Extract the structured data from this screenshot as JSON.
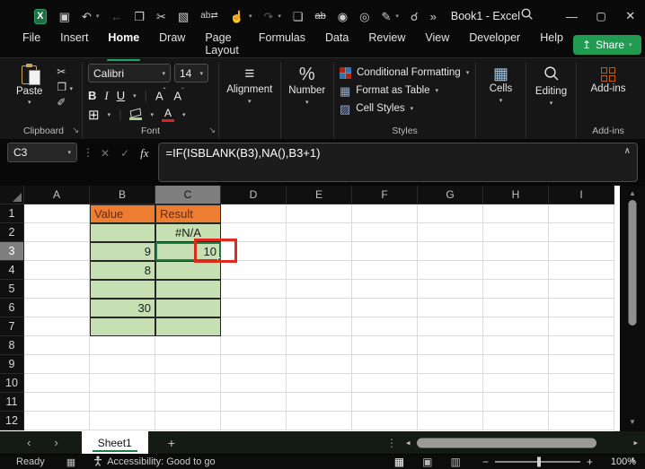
{
  "titlebar": {
    "title": "Book1 - Excel",
    "excel_logo": "X",
    "qat": [
      {
        "name": "save-icon",
        "glyph": "▣"
      },
      {
        "name": "undo-icon",
        "glyph": "↶",
        "chevron": true
      },
      {
        "name": "back-arrow-icon",
        "glyph": "←",
        "dim": true
      },
      {
        "name": "copy-icon",
        "glyph": "❐"
      },
      {
        "name": "cut-icon",
        "glyph": "✂"
      },
      {
        "name": "picture-edit-icon",
        "glyph": "▧"
      },
      {
        "name": "replace-icon",
        "glyph": "ab⇄"
      },
      {
        "name": "touch-mode-icon",
        "glyph": "☝",
        "chevron": true
      },
      {
        "name": "redo-icon",
        "glyph": "↷",
        "chevron": true,
        "dim": true
      },
      {
        "name": "new-file-icon",
        "glyph": "❏"
      },
      {
        "name": "strikethrough-icon",
        "glyph": "ab"
      },
      {
        "name": "camera-icon",
        "glyph": "◉"
      },
      {
        "name": "document-inspect-icon",
        "glyph": "◎"
      },
      {
        "name": "draw-pen-icon",
        "glyph": "✎",
        "chevron": true
      },
      {
        "name": "person-search-icon",
        "glyph": "☌"
      },
      {
        "name": "more-commands-icon",
        "glyph": "»"
      }
    ]
  },
  "tabs": {
    "items": [
      "File",
      "Insert",
      "Home",
      "Draw",
      "Page Layout",
      "Formulas",
      "Data",
      "Review",
      "View",
      "Developer",
      "Help"
    ],
    "active": "Home",
    "share_label": "Share"
  },
  "ribbon": {
    "clipboard": {
      "group": "Clipboard",
      "paste": "Paste"
    },
    "font": {
      "group": "Font",
      "font_name": "Calibri",
      "font_size": "14",
      "bold": "B",
      "italic": "I",
      "underline": "U",
      "grow": "A",
      "shrink": "A",
      "font_color_a": "A"
    },
    "alignment": {
      "group": "Alignment"
    },
    "number": {
      "group": "Number",
      "icon": "%"
    },
    "styles": {
      "group": "Styles",
      "conditional": "Conditional Formatting",
      "format_table": "Format as Table",
      "cell_styles": "Cell Styles"
    },
    "cells": {
      "group": "Cells"
    },
    "editing": {
      "group": "Editing"
    },
    "addins": {
      "group": "Add-ins",
      "button": "Add-ins"
    }
  },
  "formula_bar": {
    "name_box": "C3",
    "fx": "fx",
    "cancel": "✕",
    "enter": "✓",
    "formula": "=IF(ISBLANK(B3),NA(),B3+1)"
  },
  "sheet": {
    "columns": [
      "A",
      "B",
      "C",
      "D",
      "E",
      "F",
      "G",
      "H",
      "I"
    ],
    "row_count": 12,
    "cells": {
      "B1": "Value",
      "C1": "Result",
      "C2": "#N/A",
      "B3": "9",
      "C3": "10",
      "B4": "8",
      "B6": "30"
    },
    "orange_cells": [
      "B1",
      "C1"
    ],
    "green_cells": [
      "B2",
      "C2",
      "B3",
      "C3",
      "B4",
      "C4",
      "B5",
      "C5",
      "B6",
      "C6",
      "B7",
      "C7"
    ],
    "selected_cell": "C3",
    "highlight_column": "C",
    "highlight_row": 3,
    "fill_orange": "#ED7D31",
    "fill_green": "#C6E0B4",
    "annotation": {
      "target": "C3",
      "color": "#e0281c"
    }
  },
  "sheet_tabs": {
    "active": "Sheet1",
    "add_label": "+"
  },
  "status_bar": {
    "mode": "Ready",
    "accessibility": "Accessibility: Good to go",
    "zoom_level": "100%",
    "views": [
      {
        "name": "normal-view-icon",
        "glyph": "▦",
        "active": true
      },
      {
        "name": "page-layout-view-icon",
        "glyph": "▣",
        "active": false
      },
      {
        "name": "page-break-view-icon",
        "glyph": "▥",
        "active": false
      }
    ]
  }
}
